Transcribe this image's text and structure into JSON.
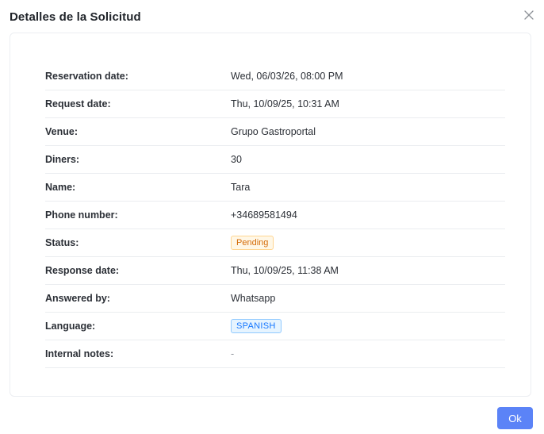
{
  "modal": {
    "title": "Detalles de la Solicitud",
    "ok_label": "Ok"
  },
  "details": [
    {
      "label": "Reservation date:",
      "value": "Wed, 06/03/26, 08:00 PM"
    },
    {
      "label": "Request date:",
      "value": "Thu, 10/09/25, 10:31 AM"
    },
    {
      "label": "Venue:",
      "value": "Grupo Gastroportal"
    },
    {
      "label": "Diners:",
      "value": "30"
    },
    {
      "label": "Name:",
      "value": "Tara"
    },
    {
      "label": "Phone number:",
      "value": "+34689581494"
    },
    {
      "label": "Status:",
      "value": "Pending"
    },
    {
      "label": "Response date:",
      "value": "Thu, 10/09/25, 11:38 AM"
    },
    {
      "label": "Answered by:",
      "value": "Whatsapp"
    },
    {
      "label": "Language:",
      "value": "SPANISH"
    },
    {
      "label": "Internal notes:",
      "value": "-"
    }
  ],
  "colors": {
    "primary": "#5b83f7",
    "status_pending_text": "#d46b08",
    "status_pending_bg": "#fff7e6",
    "language_tag_text": "#1677ff",
    "language_tag_bg": "#e6f4ff"
  },
  "icons": {
    "close": "close-icon"
  }
}
